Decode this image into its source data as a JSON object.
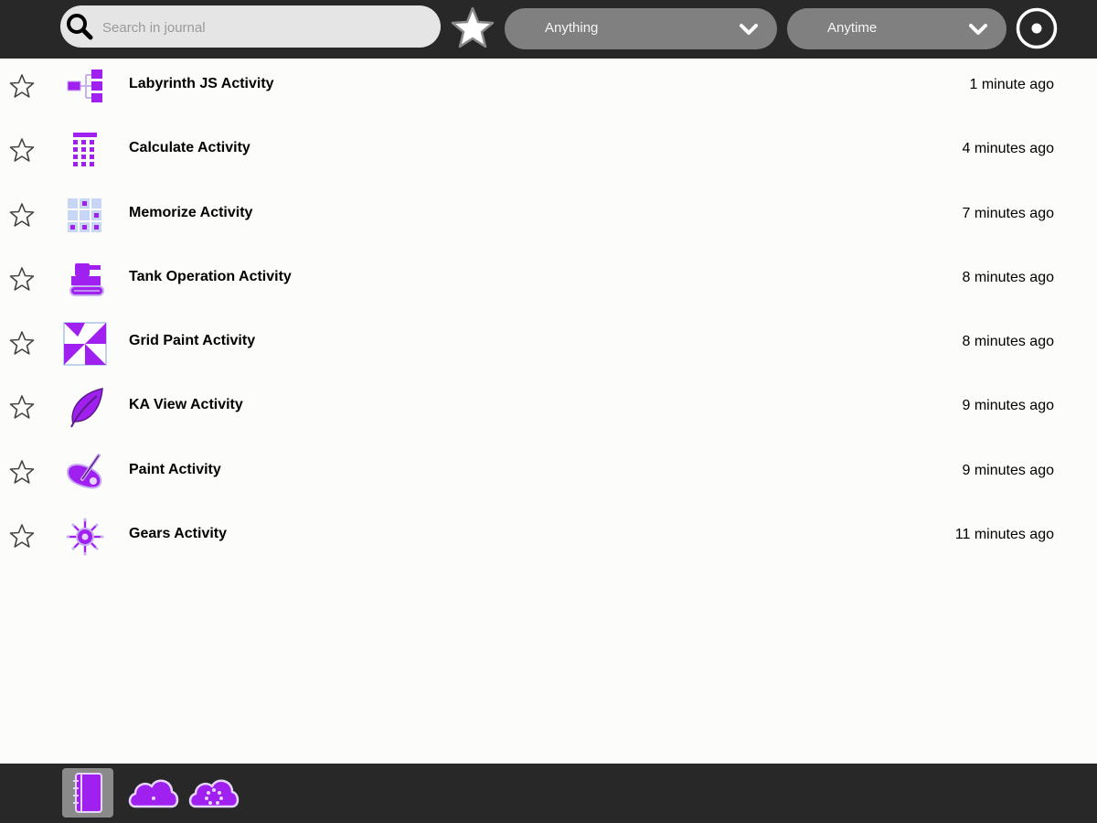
{
  "search": {
    "placeholder": "Search in journal",
    "value": ""
  },
  "filters": {
    "type_value": "Anything",
    "time_value": "Anytime"
  },
  "entries": [
    {
      "title": "Labyrinth JS Activity",
      "time": "1 minute ago",
      "icon": "labyrinth-icon",
      "favorite": false
    },
    {
      "title": "Calculate Activity",
      "time": "4 minutes ago",
      "icon": "calculate-icon",
      "favorite": false
    },
    {
      "title": "Memorize Activity",
      "time": "7 minutes ago",
      "icon": "memorize-icon",
      "favorite": false
    },
    {
      "title": "Tank Operation Activity",
      "time": "8 minutes ago",
      "icon": "tank-icon",
      "favorite": false
    },
    {
      "title": "Grid Paint Activity",
      "time": "8 minutes ago",
      "icon": "grid-paint-icon",
      "favorite": false
    },
    {
      "title": "KA View Activity",
      "time": "9 minutes ago",
      "icon": "leaf-icon",
      "favorite": false
    },
    {
      "title": "Paint Activity",
      "time": "9 minutes ago",
      "icon": "paint-icon",
      "favorite": false
    },
    {
      "title": "Gears Activity",
      "time": "11 minutes ago",
      "icon": "gears-icon",
      "favorite": false
    }
  ],
  "bottom_tabs": [
    {
      "icon": "journal-icon",
      "active": true
    },
    {
      "icon": "cloud-private-icon",
      "active": false
    },
    {
      "icon": "cloud-shared-icon",
      "active": false
    }
  ],
  "colors": {
    "accent": "#a020f0",
    "accent_stroke": "#5c1a8a",
    "toolbar": "#282828",
    "background": "#fcfcfa"
  }
}
